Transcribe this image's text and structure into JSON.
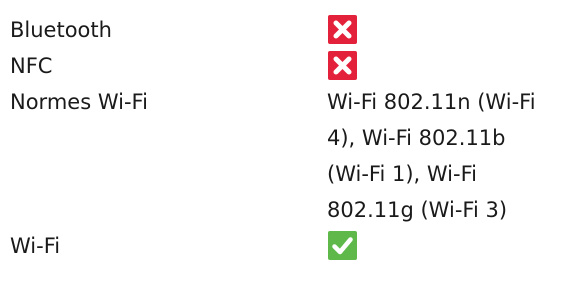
{
  "specs": [
    {
      "label": "Bluetooth",
      "value_type": "no",
      "icon": "cross-icon",
      "icon_color": "#e3213b"
    },
    {
      "label": "NFC",
      "value_type": "no",
      "icon": "cross-icon",
      "icon_color": "#e3213b"
    },
    {
      "label": "Normes Wi-Fi",
      "value_type": "text",
      "value_lines": [
        "Wi-Fi 802.11n (Wi-Fi",
        "4), Wi-Fi 802.11b",
        "(Wi-Fi 1), Wi-Fi",
        "802.11g (Wi-Fi 3)"
      ]
    },
    {
      "label": "Wi-Fi",
      "value_type": "yes",
      "icon": "checkmark-icon",
      "icon_color": "#5fb94a"
    }
  ]
}
